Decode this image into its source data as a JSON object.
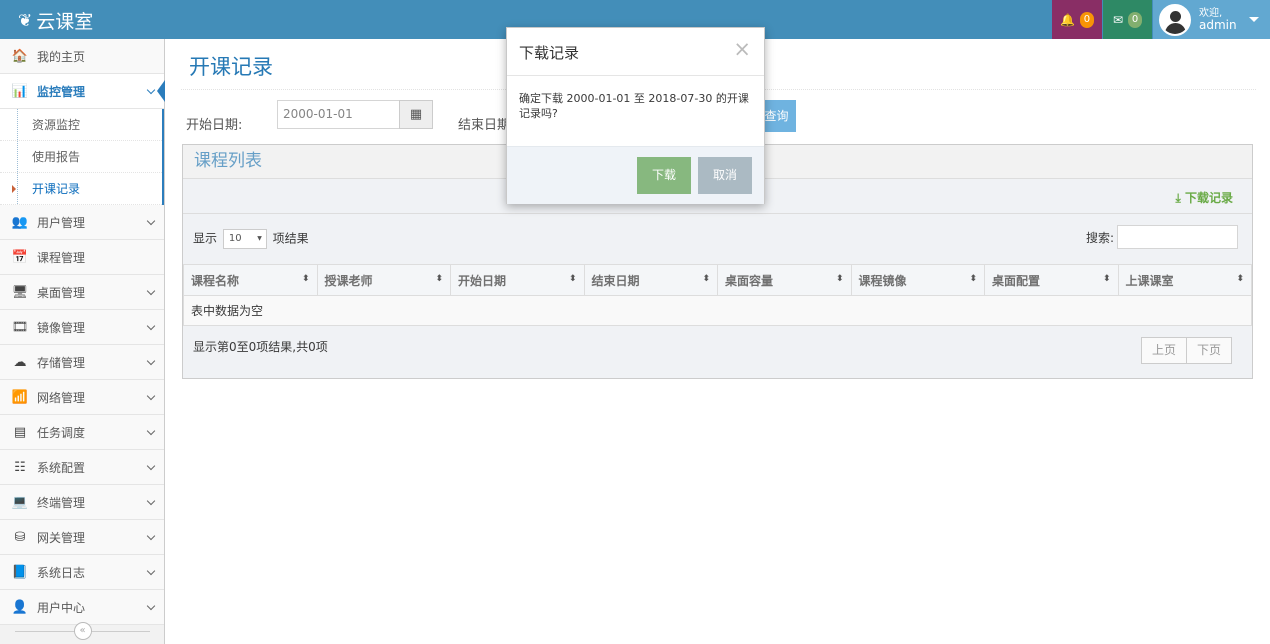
{
  "app": {
    "brand": "云课室",
    "brand_icon": "leaf-icon"
  },
  "topnav": {
    "notifications_count": "0",
    "messages_count": "0",
    "welcome": "欢迎,",
    "username": "admin"
  },
  "sidebar": {
    "items": [
      {
        "label": "我的主页",
        "icon": "home-icon",
        "glyph": "🏠"
      },
      {
        "label": "监控管理",
        "icon": "bar-chart-icon",
        "glyph": "📊"
      },
      {
        "label": "用户管理",
        "icon": "users-icon",
        "glyph": "👥"
      },
      {
        "label": "课程管理",
        "icon": "calendar-icon",
        "glyph": "📅"
      },
      {
        "label": "桌面管理",
        "icon": "desktop-icon",
        "glyph": "🖥"
      },
      {
        "label": "镜像管理",
        "icon": "film-icon",
        "glyph": "🎞"
      },
      {
        "label": "存储管理",
        "icon": "cloud-icon",
        "glyph": "☁"
      },
      {
        "label": "网络管理",
        "icon": "wifi-icon",
        "glyph": "📶"
      },
      {
        "label": "任务调度",
        "icon": "list-icon",
        "glyph": "▤"
      },
      {
        "label": "系统配置",
        "icon": "sliders-icon",
        "glyph": "☷"
      },
      {
        "label": "终端管理",
        "icon": "laptop-icon",
        "glyph": "💻"
      },
      {
        "label": "网关管理",
        "icon": "cubes-icon",
        "glyph": "⛁"
      },
      {
        "label": "系统日志",
        "icon": "book-icon",
        "glyph": "📘"
      },
      {
        "label": "用户中心",
        "icon": "user-icon",
        "glyph": "👤"
      }
    ],
    "submenu": [
      "资源监控",
      "使用报告",
      "开课记录"
    ]
  },
  "page": {
    "title": "开课记录",
    "start_label": "开始日期:",
    "start_value": "2000-01-01",
    "end_label": "结束日期",
    "query_label": "查询"
  },
  "panel": {
    "title": "课程列表",
    "download_link": "下载记录",
    "show_prefix": "显示",
    "page_length": "10",
    "show_suffix": "项结果",
    "search_label": "搜索:",
    "columns": [
      "课程名称",
      "授课老师",
      "开始日期",
      "结束日期",
      "桌面容量",
      "课程镜像",
      "桌面配置",
      "上课课室"
    ],
    "empty_text": "表中数据为空",
    "info_text": "显示第0至0项结果,共0项",
    "prev_label": "上页",
    "next_label": "下页"
  },
  "modal": {
    "title": "下载记录",
    "close_glyph": "×",
    "message": "确定下载 2000-01-01 至 2018-07-30 的开课记录吗?",
    "confirm_label": "下载",
    "cancel_label": "取消"
  },
  "colors": {
    "header": "#438eb9",
    "accent": "#2b7dbc",
    "bell_bg": "#892e65",
    "mail_bg": "#2e8965",
    "confirm": "#87b87f",
    "cancel": "#abbac3"
  }
}
